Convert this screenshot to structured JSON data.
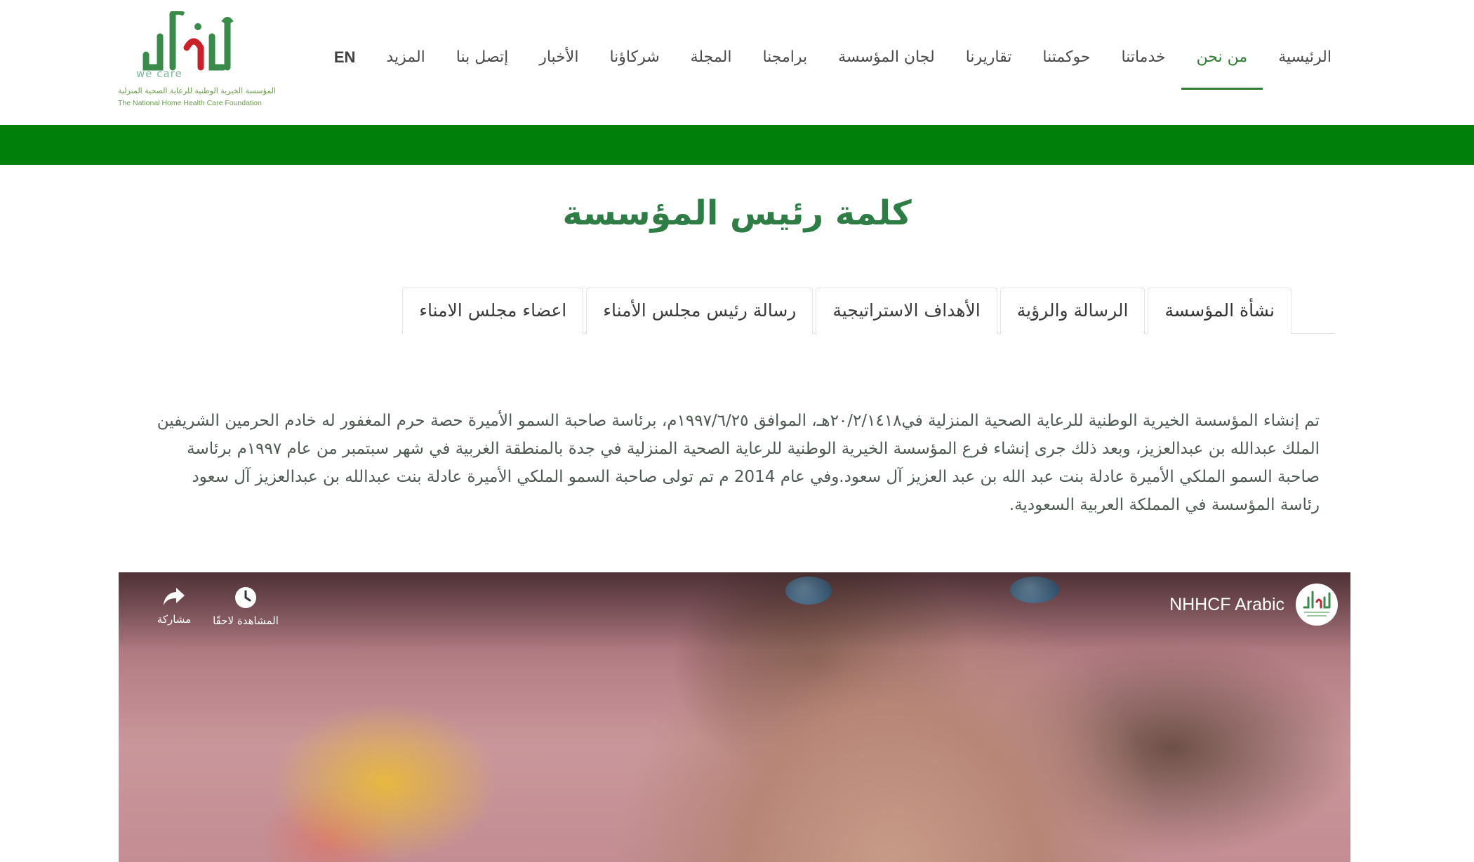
{
  "brand": {
    "logo_ar_name": "نرعاك",
    "logo_tagline": "we care",
    "logo_line_ar": "المؤسسة الخيرية الوطنية للرعاية الصحية المنزلية",
    "logo_line_en": "The National Home Health Care Foundation",
    "primary_color": "#2e7d45",
    "band_color": "#007f0b"
  },
  "nav": {
    "items": [
      {
        "label": "الرئيسية"
      },
      {
        "label": "من نحن",
        "active": true
      },
      {
        "label": "خدماتنا"
      },
      {
        "label": "حوكمتنا"
      },
      {
        "label": "تقاريرنا"
      },
      {
        "label": "لجان المؤسسة"
      },
      {
        "label": "برامجنا"
      },
      {
        "label": "المجلة"
      },
      {
        "label": "شركاؤنا"
      },
      {
        "label": "الأخبار"
      },
      {
        "label": "إتصل بنا"
      },
      {
        "label": "المزيد"
      },
      {
        "label": "EN"
      }
    ]
  },
  "page": {
    "title": "كلمة رئيس المؤسسة"
  },
  "tabs": [
    {
      "label": "نشأة المؤسسة",
      "active": true
    },
    {
      "label": "الرسالة والرؤية"
    },
    {
      "label": "الأهداف الاستراتيجية"
    },
    {
      "label": "رسالة رئيس مجلس الأمناء"
    },
    {
      "label": "اعضاء مجلس الامناء"
    }
  ],
  "intro": {
    "text": "تم إنشاء المؤسسة الخيرية الوطنية للرعاية الصحية المنزلية في٢٠/٢/١٤١٨هـ، الموافق ١٩٩٧/٦/٢٥م، برئاسة صاحبة السمو الأميرة حصة حرم المغفور له خادم الحرمين الشريفين الملك عبدالله بن عبدالعزيز، وبعد ذلك جرى إنشاء فرع المؤسسة الخيرية الوطنية للرعاية الصحية المنزلية في جدة بالمنطقة الغربية في شهر سبتمبر من عام ١٩٩٧م برئاسة صاحبة السمو الملكي الأميرة عادلة بنت عبد الله بن عبد العزيز آل سعود.وفي عام 2014 م تم تولى صاحبة السمو الملكي الأميرة عادلة بنت عبدالله بن عبدالعزيز آل سعود رئاسة المؤسسة في المملكة العربية السعودية."
  },
  "video": {
    "channel_name": "NHHCF Arabic",
    "share_label": "مشاركة",
    "watch_later_label": "المشاهدة لاحقًا"
  }
}
